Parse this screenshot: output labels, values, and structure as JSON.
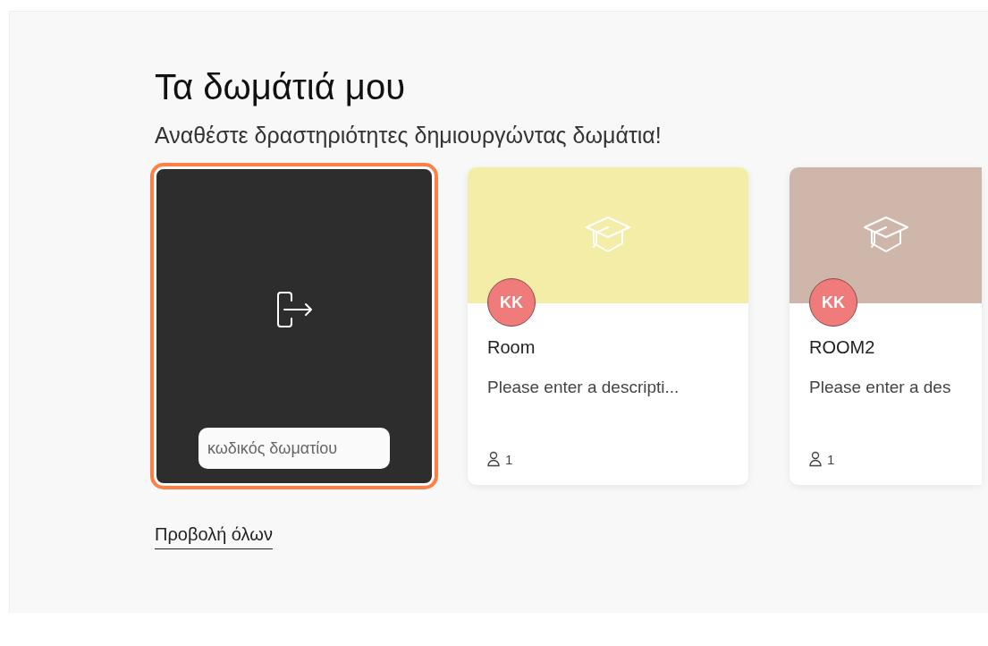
{
  "heading": "Τα δωμάτιά μου",
  "subtitle": "Αναθέστε δραστηριότητες δημιουργώντας δωμάτια!",
  "join_card": {
    "highlighted": true,
    "code_field": {
      "placeholder": "κωδικός δωματίου"
    }
  },
  "rooms": [
    {
      "color": "#f3eda8",
      "avatar": "KK",
      "name": "Room",
      "description": "Please enter a descripti...",
      "members": "1"
    },
    {
      "color": "#cfb6aa",
      "avatar": "KK",
      "name": "ROOM2",
      "description": "Please enter a des",
      "members": "1"
    }
  ],
  "view_all_link": "Προβολή όλων"
}
